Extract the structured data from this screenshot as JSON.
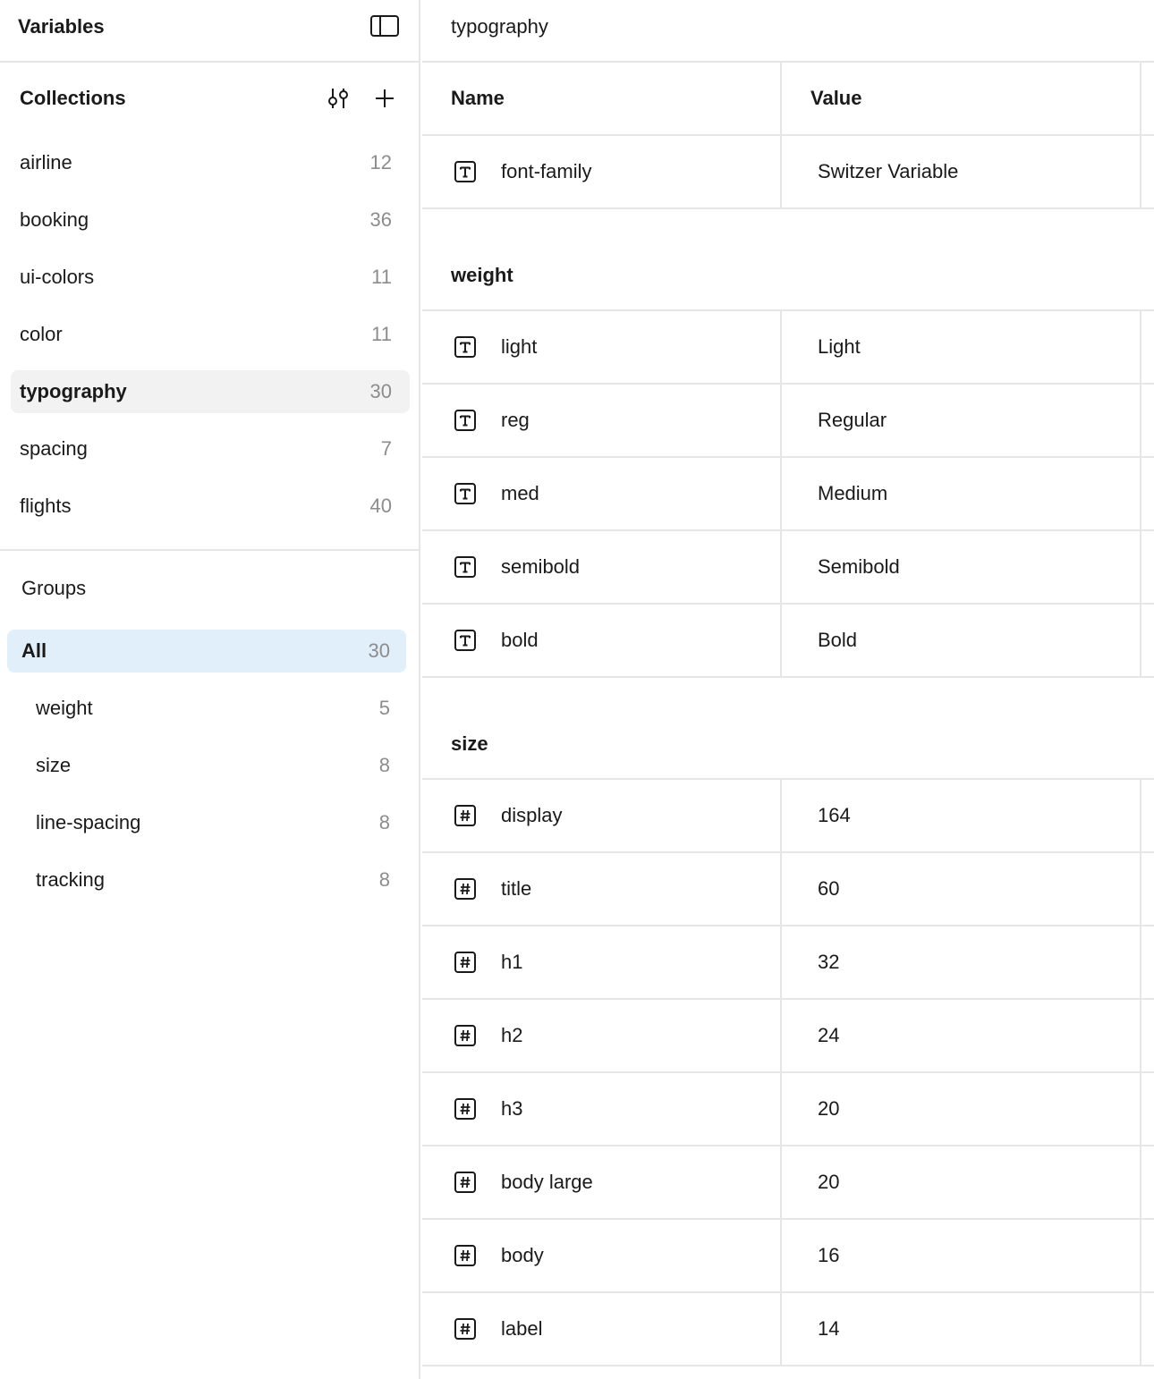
{
  "sidebar": {
    "title": "Variables",
    "collections_title": "Collections",
    "collections": [
      {
        "name": "airline",
        "count": "12"
      },
      {
        "name": "booking",
        "count": "36"
      },
      {
        "name": "ui-colors",
        "count": "11"
      },
      {
        "name": "color",
        "count": "11"
      },
      {
        "name": "typography",
        "count": "30"
      },
      {
        "name": "spacing",
        "count": "7"
      },
      {
        "name": "flights",
        "count": "40"
      }
    ],
    "selected_collection": "typography",
    "groups_title": "Groups",
    "groups": [
      {
        "name": "All",
        "count": "30"
      },
      {
        "name": "weight",
        "count": "5"
      },
      {
        "name": "size",
        "count": "8"
      },
      {
        "name": "line-spacing",
        "count": "8"
      },
      {
        "name": "tracking",
        "count": "8"
      }
    ],
    "selected_group": "All"
  },
  "main": {
    "title": "typography",
    "columns": {
      "name": "Name",
      "value": "Value"
    },
    "top_rows": [
      {
        "icon": "text-type-icon",
        "name": "font-family",
        "value": "Switzer Variable"
      }
    ],
    "groups": [
      {
        "label": "weight",
        "rows": [
          {
            "icon": "text-type-icon",
            "name": "light",
            "value": "Light"
          },
          {
            "icon": "text-type-icon",
            "name": "reg",
            "value": "Regular"
          },
          {
            "icon": "text-type-icon",
            "name": "med",
            "value": "Medium"
          },
          {
            "icon": "text-type-icon",
            "name": "semibold",
            "value": "Semibold"
          },
          {
            "icon": "text-type-icon",
            "name": "bold",
            "value": "Bold"
          }
        ]
      },
      {
        "label": "size",
        "rows": [
          {
            "icon": "number-type-icon",
            "name": "display",
            "value": "164"
          },
          {
            "icon": "number-type-icon",
            "name": "title",
            "value": "60"
          },
          {
            "icon": "number-type-icon",
            "name": "h1",
            "value": "32"
          },
          {
            "icon": "number-type-icon",
            "name": "h2",
            "value": "24"
          },
          {
            "icon": "number-type-icon",
            "name": "h3",
            "value": "20"
          },
          {
            "icon": "number-type-icon",
            "name": "body large",
            "value": "20"
          },
          {
            "icon": "number-type-icon",
            "name": "body",
            "value": "16"
          },
          {
            "icon": "number-type-icon",
            "name": "label",
            "value": "14"
          }
        ]
      }
    ]
  }
}
